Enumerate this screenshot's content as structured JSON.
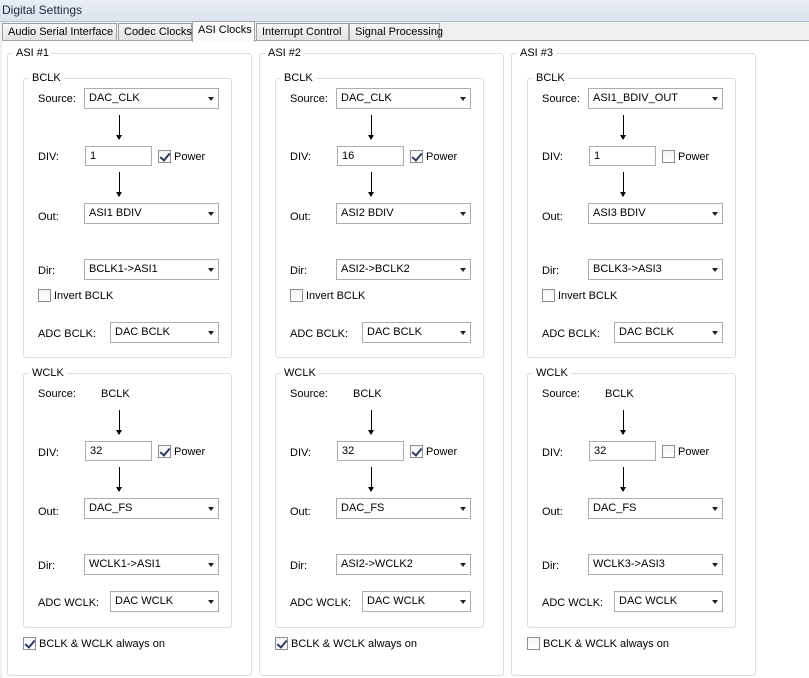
{
  "window": {
    "title": "Digital Settings"
  },
  "tabs": [
    {
      "label": "Audio Serial Interface"
    },
    {
      "label": "Codec Clocks"
    },
    {
      "label": "ASI Clocks",
      "active": true
    },
    {
      "label": "Interrupt Control"
    },
    {
      "label": "Signal Processing"
    }
  ],
  "labels": {
    "bclk": "BCLK",
    "wclk": "WCLK",
    "source": "Source:",
    "div": "DIV:",
    "out": "Out:",
    "dir": "Dir:",
    "power": "Power",
    "invert_bclk": "Invert BCLK",
    "adc_bclk": "ADC BCLK:",
    "adc_wclk": "ADC WCLK:",
    "always_on": "BCLK & WCLK always on"
  },
  "asi": [
    {
      "title": "ASI #1",
      "bclk": {
        "source": "DAC_CLK",
        "div": "1",
        "power": true,
        "out": "ASI1 BDIV",
        "dir": "BCLK1->ASI1",
        "invert": false,
        "adc_bclk": "DAC BCLK"
      },
      "wclk": {
        "source": "BCLK",
        "div": "32",
        "power": true,
        "out": "DAC_FS",
        "dir": "WCLK1->ASI1",
        "adc_wclk": "DAC WCLK"
      },
      "always_on": true
    },
    {
      "title": "ASI #2",
      "bclk": {
        "source": "DAC_CLK",
        "div": "16",
        "power": true,
        "out": "ASI2 BDIV",
        "dir": "ASI2->BCLK2",
        "invert": false,
        "adc_bclk": "DAC BCLK"
      },
      "wclk": {
        "source": "BCLK",
        "div": "32",
        "power": true,
        "out": "DAC_FS",
        "dir": "ASI2->WCLK2",
        "adc_wclk": "DAC WCLK"
      },
      "always_on": true
    },
    {
      "title": "ASI #3",
      "bclk": {
        "source": "ASI1_BDIV_OUT",
        "div": "1",
        "power": false,
        "out": "ASI3 BDIV",
        "dir": "BCLK3->ASI3",
        "invert": false,
        "adc_bclk": "DAC BCLK"
      },
      "wclk": {
        "source": "BCLK",
        "div": "32",
        "power": false,
        "out": "DAC_FS",
        "dir": "WCLK3->ASI3",
        "adc_wclk": "DAC WCLK"
      },
      "always_on": false
    }
  ]
}
